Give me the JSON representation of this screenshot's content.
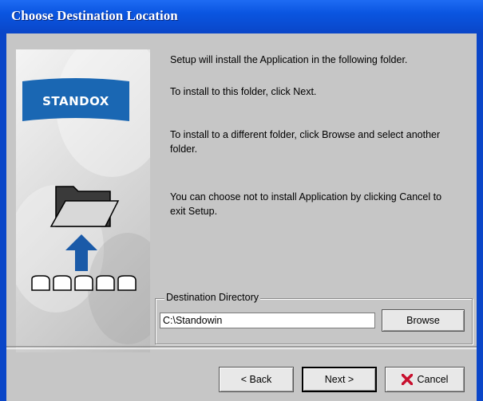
{
  "window": {
    "title": "Choose Destination Location"
  },
  "sidepanel": {
    "brand": "STANDOX"
  },
  "messages": [
    "Setup will install the Application in the following folder.",
    "To install to this folder, click Next.",
    "To install to a different folder, click Browse and select another folder.",
    "You can choose not to install Application by clicking Cancel to exit Setup."
  ],
  "destination": {
    "group_label": "Destination Directory",
    "path": "C:\\Standowin",
    "browse_label": "Browse"
  },
  "buttons": {
    "back": "< Back",
    "next": "Next >",
    "cancel": "Cancel"
  },
  "colors": {
    "titlebar": "#0a46c8",
    "dialog_bg": "#c6c6c6",
    "banner": "#1a67b3",
    "cancel_x": "#c8102e",
    "arrow": "#1a5aa8"
  },
  "icons": [
    "folder-open-icon",
    "up-arrow-icon",
    "disk-row-icon",
    "cancel-x-icon"
  ]
}
